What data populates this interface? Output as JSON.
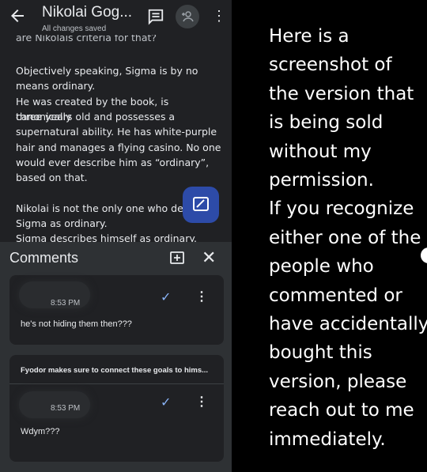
{
  "topbar": {
    "title": "Nikolai Gog...",
    "status": "All changes saved",
    "icons": [
      "back-arrow-icon",
      "comment-icon",
      "add-person-icon",
      "more-vert-icon"
    ]
  },
  "document": {
    "cut_line": "are Nikolais criteria for that?",
    "p1_l1": "Objectively speaking, Sigma is by no",
    "p1_l2": "means ordinary.",
    "p1_l3": "He was created by the book, is canonically",
    "p1_l4": "three years old and possesses a",
    "p1_l5": "supernatural  ability. He has white-purple",
    "p1_l6": "hair and manages a flying casino. No one",
    "p1_l7": "would ever describe  him as “ordinary”,",
    "p1_l8": "based on that.",
    "p2_l1": "Nikolai is not the only one who des",
    "p2_l2": "Sigma as ordinary.",
    "p2_l3": "Sigma describes himself as ordinary. Sigma"
  },
  "comments": {
    "header": "Comments",
    "items": [
      {
        "time": "8:53 PM",
        "text": "he's not hiding them then???"
      },
      {
        "quote": "Fyodor makes sure to connect these goals to hims...",
        "time": "8:53 PM",
        "text": "Wdym???"
      }
    ]
  },
  "caption": {
    "lines": [
      "Here is a",
      "screenshot of",
      "the version that",
      "is being sold",
      "without my",
      "permission.",
      "If you recognize",
      "either one of the",
      "people who",
      "commented or",
      "have accidentally",
      "bought this",
      "version, please",
      "reach out to me",
      "immediately."
    ]
  },
  "colors": {
    "background": "#000000",
    "app_surface": "#202124",
    "comments_panel": "#2e3134",
    "accent_blue": "#8ab4f8",
    "fab_blue": "#2d4ba8",
    "text": "#e8eaed"
  }
}
